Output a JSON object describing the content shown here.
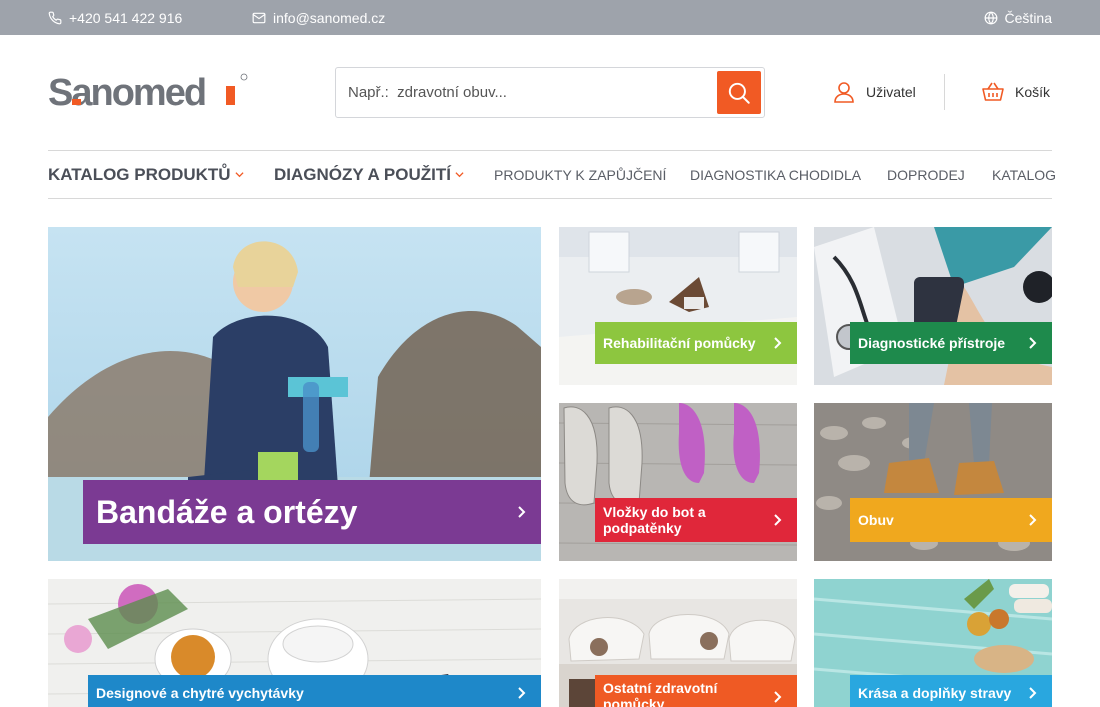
{
  "topbar": {
    "phone": "+420 541 422 916",
    "email": "info@sanomed.cz",
    "language": "Čeština",
    "icons": [
      "phone-icon",
      "mail-icon",
      "globe-icon"
    ]
  },
  "header": {
    "logo_text": "Sanomed",
    "search_placeholder": "Např.:  zdravotní obuv...",
    "search_button_icon": "search-icon",
    "user_label": "Uživatel",
    "cart_label": "Košík"
  },
  "nav": {
    "items": [
      {
        "label": "KATALOG PRODUKTŮ",
        "dropdown": true
      },
      {
        "label": "DIAGNÓZY A POUŽITÍ",
        "dropdown": true
      },
      {
        "label": "PRODUKTY K ZAPŮJČENÍ",
        "dropdown": false
      },
      {
        "label": "DIAGNOSTIKA CHODIDLA",
        "dropdown": false
      },
      {
        "label": "DOPRODEJ",
        "dropdown": false
      },
      {
        "label": "KATALOG",
        "dropdown": false
      }
    ]
  },
  "tiles": [
    {
      "label": "Bandáže a ortézy",
      "color": "#7b3a93"
    },
    {
      "label": "Rehabilitační pomůcky",
      "color": "#8dc63f"
    },
    {
      "label": "Diagnostické přístroje",
      "color": "#1e8a4c"
    },
    {
      "label": "Vložky do bot a podpatěnky",
      "color": "#e0273a"
    },
    {
      "label": "Obuv",
      "color": "#f0a81e"
    },
    {
      "label": "Designové a chytré vychytávky",
      "color": "#1e88c9"
    },
    {
      "label": "Ostatní zdravotní pomůcky",
      "color": "#ef5a24"
    },
    {
      "label": "Krása a doplňky stravy",
      "color": "#29a7df"
    }
  ],
  "colors": {
    "accent": "#f15a24",
    "topbar": "#9ea3ab"
  }
}
